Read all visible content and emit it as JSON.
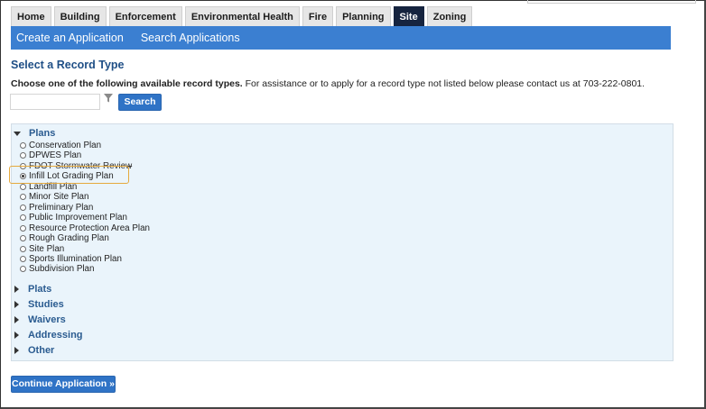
{
  "tabs": [
    {
      "label": "Home",
      "active": false
    },
    {
      "label": "Building",
      "active": false
    },
    {
      "label": "Enforcement",
      "active": false
    },
    {
      "label": "Environmental Health",
      "active": false
    },
    {
      "label": "Fire",
      "active": false
    },
    {
      "label": "Planning",
      "active": false
    },
    {
      "label": "Site",
      "active": true
    },
    {
      "label": "Zoning",
      "active": false
    }
  ],
  "subnav": {
    "create": "Create an Application",
    "search": "Search Applications"
  },
  "page": {
    "title": "Select a Record Type",
    "instructions_bold": "Choose one of the following available record types.",
    "instructions_rest": " For assistance or to apply for a record type not listed below please contact us at 703-222-0801."
  },
  "search": {
    "value": "",
    "placeholder": "",
    "button": "Search"
  },
  "sections": [
    {
      "label": "Plans",
      "expanded": true
    },
    {
      "label": "Plats",
      "expanded": false
    },
    {
      "label": "Studies",
      "expanded": false
    },
    {
      "label": "Waivers",
      "expanded": false
    },
    {
      "label": "Addressing",
      "expanded": false
    },
    {
      "label": "Other",
      "expanded": false
    }
  ],
  "plans": [
    {
      "label": "Conservation Plan",
      "checked": false
    },
    {
      "label": "DPWES Plan",
      "checked": false
    },
    {
      "label": "FDOT Stormwater Review",
      "checked": false
    },
    {
      "label": "Infill Lot Grading Plan",
      "checked": true
    },
    {
      "label": "Landfill Plan",
      "checked": false
    },
    {
      "label": "Minor Site Plan",
      "checked": false
    },
    {
      "label": "Preliminary Plan",
      "checked": false
    },
    {
      "label": "Public Improvement Plan",
      "checked": false
    },
    {
      "label": "Resource Protection Area Plan",
      "checked": false
    },
    {
      "label": "Rough Grading Plan",
      "checked": false
    },
    {
      "label": "Site Plan",
      "checked": false
    },
    {
      "label": "Sports Illumination Plan",
      "checked": false
    },
    {
      "label": "Subdivision Plan",
      "checked": false
    }
  ],
  "continue_button": "Continue Application »",
  "colors": {
    "accent": "#3b7fd1",
    "active_tab": "#16243f",
    "button": "#2f73c6",
    "panel": "#eaf4fb",
    "highlight": "#e5a93d",
    "section_text": "#2a5b90"
  },
  "icons": {
    "filter": "filter-funnel-icon",
    "expanded": "caret-down-icon",
    "collapsed": "caret-right-icon"
  }
}
